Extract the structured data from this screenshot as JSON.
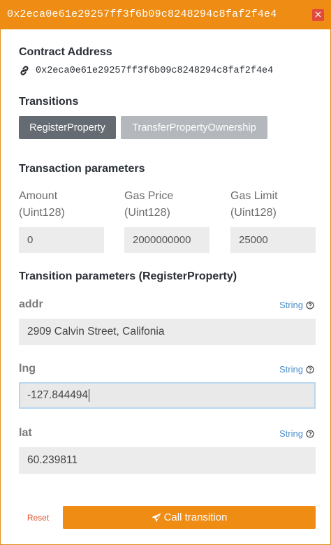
{
  "header": {
    "title": "0x2eca0e61e29257ff3f6b09c8248294c8faf2f4e4",
    "close_glyph": "×"
  },
  "contract": {
    "heading": "Contract Address",
    "address": "0x2eca0e61e29257ff3f6b09c8248294c8faf2f4e4",
    "icon": "link-icon"
  },
  "transitions": {
    "heading": "Transitions",
    "items": [
      {
        "label": "RegisterProperty",
        "selected": true
      },
      {
        "label": "TransferPropertyOwnership",
        "selected": false
      }
    ]
  },
  "tx_params": {
    "heading": "Transaction parameters",
    "amount": {
      "label": "Amount",
      "type": "(Uint128)",
      "value": "0"
    },
    "gas_price": {
      "label": "Gas Price",
      "type": "(Uint128)",
      "value": "2000000000"
    },
    "gas_limit": {
      "label": "Gas Limit",
      "type": "(Uint128)",
      "value": "25000"
    }
  },
  "transition_params": {
    "heading": "Transition parameters (RegisterProperty)",
    "fields": [
      {
        "name": "addr",
        "type": "String",
        "value": "2909 Calvin Street, Califonia",
        "focused": false
      },
      {
        "name": "lng",
        "type": "String",
        "value": "-127.844494",
        "focused": true
      },
      {
        "name": "lat",
        "type": "String",
        "value": "60.239811",
        "focused": false
      }
    ]
  },
  "actions": {
    "reset_label": "Reset",
    "call_label": "Call transition",
    "call_icon": "send-icon"
  },
  "colors": {
    "accent": "#ee8c13",
    "close": "#e24b3c",
    "selected_tab": "#646b73",
    "unselected_tab": "#b4b8bc",
    "type_hint": "#4c8fc9",
    "reset_text": "#e0552e"
  }
}
